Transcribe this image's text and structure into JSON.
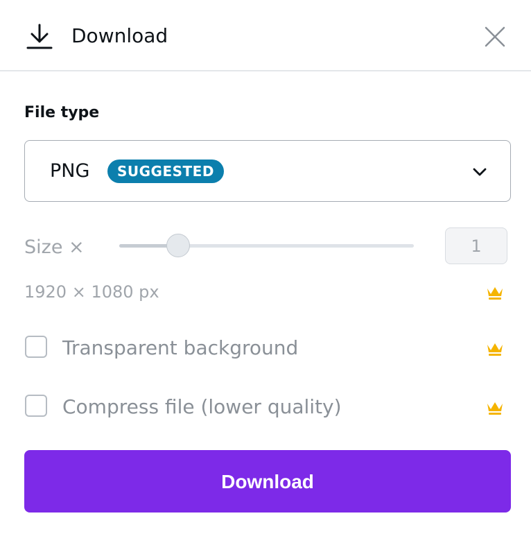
{
  "header": {
    "title": "Download",
    "icon": "download-icon",
    "close_icon": "close-icon"
  },
  "file_type": {
    "label": "File type",
    "selected": "PNG",
    "badge": "SUGGESTED",
    "badge_color": "#0c7fad"
  },
  "size": {
    "label": "Size ×",
    "value": "1",
    "slider_fraction": 0.2,
    "dimensions": "1920 × 1080 px",
    "premium_icon": "crown-icon"
  },
  "options": [
    {
      "label": "Transparent background",
      "checked": false,
      "premium_icon": "crown-icon"
    },
    {
      "label": "Compress file (lower quality)",
      "checked": false,
      "premium_icon": "crown-icon"
    }
  ],
  "download_button": {
    "label": "Download",
    "color": "#7d2ae8"
  },
  "colors": {
    "accent": "#7d2ae8",
    "crown": "#f5b400",
    "muted_text": "#a0a5ab"
  }
}
